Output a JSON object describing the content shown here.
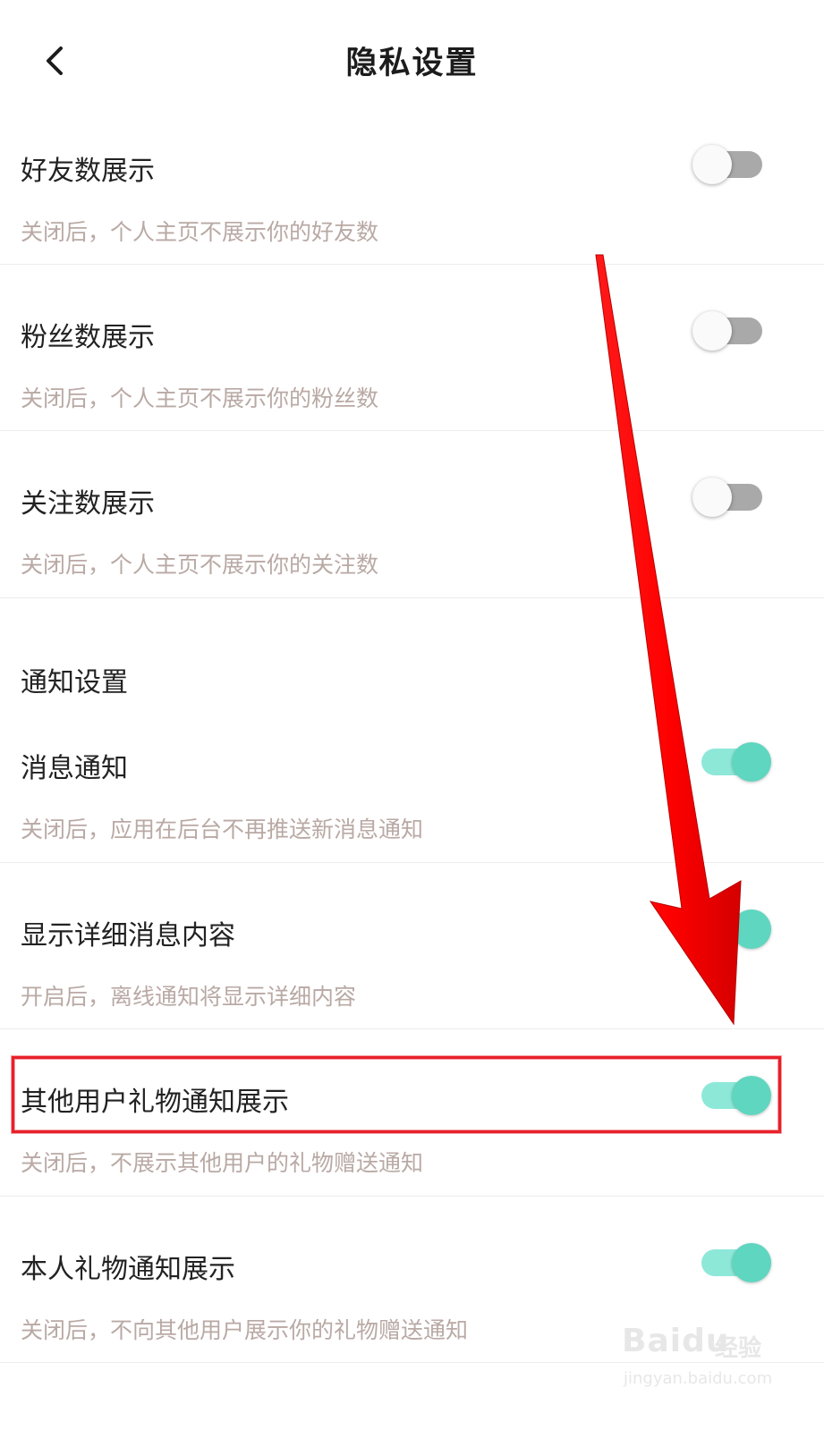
{
  "header": {
    "title": "隐私设置",
    "back_icon": "chevron-left-icon"
  },
  "privacy_items": [
    {
      "title": "好友数展示",
      "desc": "关闭后，个人主页不展示你的好友数",
      "enabled": false
    },
    {
      "title": "粉丝数展示",
      "desc": "关闭后，个人主页不展示你的粉丝数",
      "enabled": false
    },
    {
      "title": "关注数展示",
      "desc": "关闭后，个人主页不展示你的关注数",
      "enabled": false
    }
  ],
  "notification_section": {
    "title": "通知设置",
    "items": [
      {
        "title": "消息通知",
        "desc": "关闭后，应用在后台不再推送新消息通知",
        "enabled": true
      },
      {
        "title": "显示详细消息内容",
        "desc": "开启后，离线通知将显示详细内容",
        "enabled": true
      },
      {
        "title": "其他用户礼物通知展示",
        "desc": "关闭后，不展示其他用户的礼物赠送通知",
        "enabled": true
      },
      {
        "title": "本人礼物通知展示",
        "desc": "关闭后，不向其他用户展示你的礼物赠送通知",
        "enabled": true
      }
    ]
  },
  "annotation": {
    "arrow_color": "#ff0000",
    "highlight_color": "#e8202a"
  },
  "watermark": {
    "brand": "Baidu",
    "cn": "经验",
    "url": "jingyan.baidu.com"
  },
  "colors": {
    "toggle_on_track": "#8de8d8",
    "toggle_on_knob": "#5fd6bf",
    "toggle_off_track": "#a9a9a9",
    "desc_text": "#b9a9a4"
  }
}
